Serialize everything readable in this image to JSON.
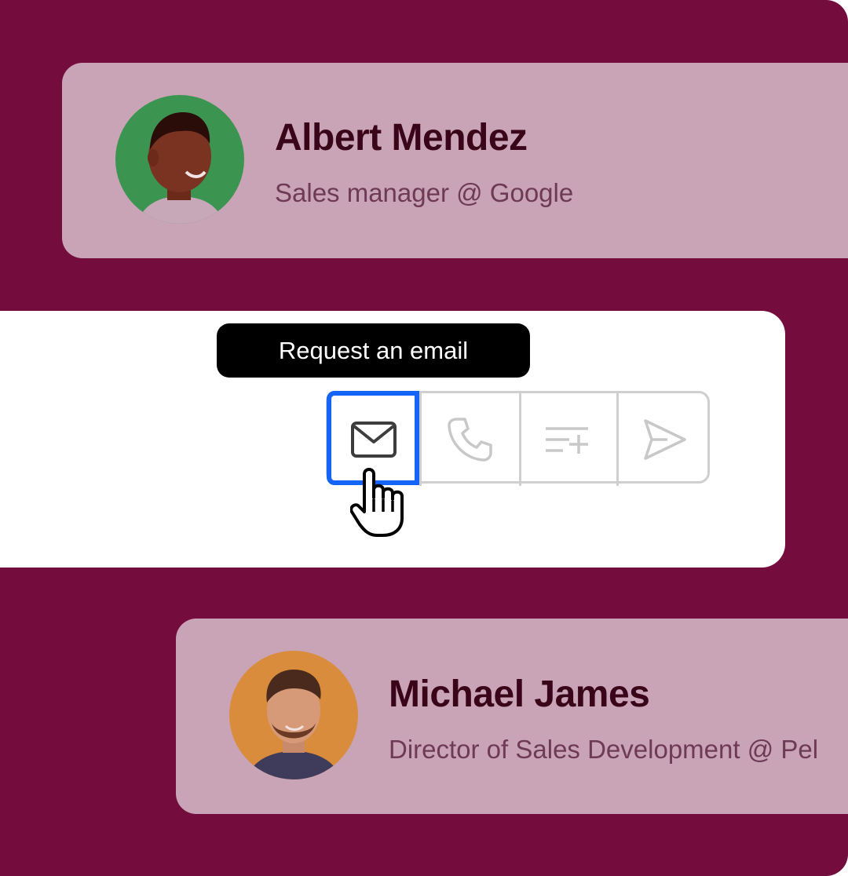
{
  "colors": {
    "background": "#740c3d",
    "card_bg": "#c9a3b6",
    "name_text": "#3a0519",
    "role_text": "#6e3a55",
    "panel_bg": "#ffffff",
    "tooltip_bg": "#000000",
    "tooltip_text": "#ffffff",
    "toolbar_border": "#cfcfcf",
    "active_icon": "#3d3d3d",
    "inactive_icon": "#c8c8c8",
    "focus_ring": "#1464f6",
    "avatar_green": "#3c9451",
    "avatar_orange": "#d98d3c"
  },
  "contacts": [
    {
      "name": "Albert Mendez",
      "role": "Sales manager @ Google",
      "avatar_bg": "#3c9451"
    },
    {
      "name": "Michael James",
      "role": "Director of Sales Development @ Pel",
      "avatar_bg": "#d98d3c"
    }
  ],
  "tooltip": {
    "label": "Request an email"
  },
  "toolbar": {
    "buttons": [
      {
        "icon": "envelope-icon",
        "state": "active"
      },
      {
        "icon": "phone-icon",
        "state": "inactive"
      },
      {
        "icon": "add-to-list-icon",
        "state": "inactive"
      },
      {
        "icon": "send-icon",
        "state": "inactive"
      }
    ]
  },
  "cursor": {
    "icon": "hand-pointer-icon"
  }
}
